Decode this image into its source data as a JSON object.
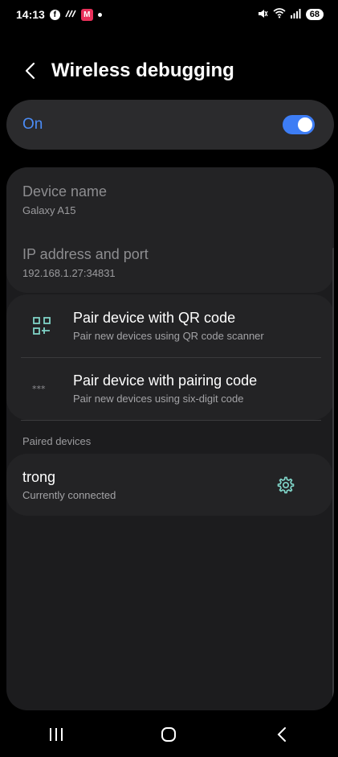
{
  "status_bar": {
    "time": "14:13",
    "battery": "68",
    "icons": [
      "facebook-icon",
      "signal-app-icon",
      "app-notification-icon",
      "mute-icon",
      "wifi-icon",
      "cell-signal-icon"
    ]
  },
  "header": {
    "title": "Wireless debugging"
  },
  "toggle": {
    "label": "On",
    "state": true,
    "accent_color": "#3d7df5"
  },
  "info": {
    "device_name_title": "Device name",
    "device_name_value": "Galaxy A15",
    "ip_title": "IP address and port",
    "ip_value": "192.168.1.27:34831"
  },
  "pair_options": [
    {
      "title": "Pair device with QR code",
      "subtitle": "Pair new devices using QR code scanner",
      "icon": "qr-code-icon"
    },
    {
      "title": "Pair device with pairing code",
      "subtitle": "Pair new devices using six-digit code",
      "icon": "pairing-code-icon"
    }
  ],
  "paired_devices": {
    "section_label": "Paired devices",
    "devices": [
      {
        "name": "trong",
        "status": "Currently connected",
        "icon": "gear-icon"
      }
    ]
  },
  "nav": {
    "items": [
      "recent-apps-icon",
      "home-icon",
      "back-icon"
    ]
  }
}
